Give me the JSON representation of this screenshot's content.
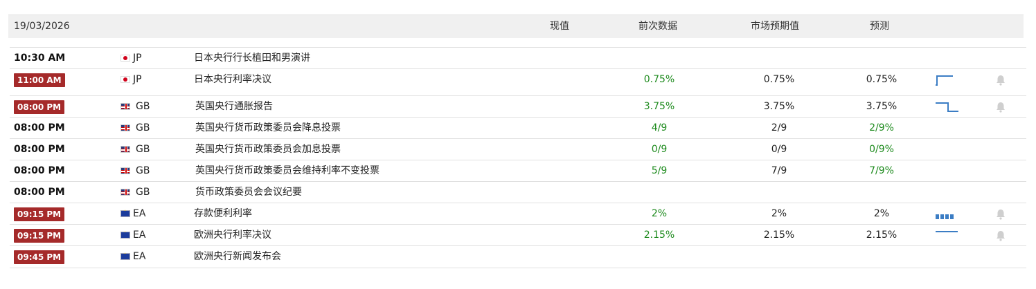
{
  "header": {
    "date": "19/03/2026",
    "col_actual": "现值",
    "col_previous": "前次数据",
    "col_consensus": "市场预期值",
    "col_forecast": "预测"
  },
  "rows": [
    {
      "time": "10:30 AM",
      "badge": false,
      "country": "JP",
      "flag": "jp",
      "event": "日本央行行长植田和男演讲",
      "previous": "",
      "consensus": "",
      "forecast": "",
      "chart": "none",
      "bell": false
    },
    {
      "time": "11:00 AM",
      "badge": true,
      "country": "JP",
      "flag": "jp",
      "event": "日本央行利率决议",
      "previous": "0.75%",
      "consensus": "0.75%",
      "forecast": "0.75%",
      "chart": "step-up",
      "bell": true
    },
    {
      "time": "08:00 PM",
      "badge": true,
      "country": "GB",
      "flag": "gb",
      "event": "英国央行通胀报告",
      "previous": "3.75%",
      "consensus": "3.75%",
      "forecast": "3.75%",
      "chart": "step-down",
      "bell": true
    },
    {
      "time": "08:00 PM",
      "badge": false,
      "country": "GB",
      "flag": "gb",
      "event": "英国央行货币政策委员会降息投票",
      "previous": "4/9",
      "consensus": "2/9",
      "forecast": "2/9%",
      "chart": "none",
      "bell": false
    },
    {
      "time": "08:00 PM",
      "badge": false,
      "country": "GB",
      "flag": "gb",
      "event": "英国央行货币政策委员会加息投票",
      "previous": "0/9",
      "consensus": "0/9",
      "forecast": "0/9%",
      "chart": "none",
      "bell": false
    },
    {
      "time": "08:00 PM",
      "badge": false,
      "country": "GB",
      "flag": "gb",
      "event": "英国央行货币政策委员会维持利率不变投票",
      "previous": "5/9",
      "consensus": "7/9",
      "forecast": "7/9%",
      "chart": "none",
      "bell": false
    },
    {
      "time": "08:00 PM",
      "badge": false,
      "country": "GB",
      "flag": "gb",
      "event": "货币政策委员会会议纪要",
      "previous": "",
      "consensus": "",
      "forecast": "",
      "chart": "none",
      "bell": false
    },
    {
      "time": "09:15 PM",
      "badge": true,
      "country": "EA",
      "flag": "ea",
      "event": "存款便利利率",
      "previous": "2%",
      "consensus": "2%",
      "forecast": "2%",
      "chart": "bars",
      "bell": true
    },
    {
      "time": "09:15 PM",
      "badge": true,
      "country": "EA",
      "flag": "ea",
      "event": "欧洲央行利率决议",
      "previous": "2.15%",
      "consensus": "2.15%",
      "forecast": "2.15%",
      "chart": "flat",
      "bell": true
    },
    {
      "time": "09:45 PM",
      "badge": true,
      "country": "EA",
      "flag": "ea",
      "event": "欧洲央行新闻发布会",
      "previous": "",
      "consensus": "",
      "forecast": "",
      "chart": "none",
      "bell": false
    }
  ],
  "colors": {
    "badge_bg": "#a52a2a",
    "previous_green": "#1c8a1c",
    "spark_blue": "#3b7dc4",
    "bell_gray": "#cfcfcf"
  }
}
